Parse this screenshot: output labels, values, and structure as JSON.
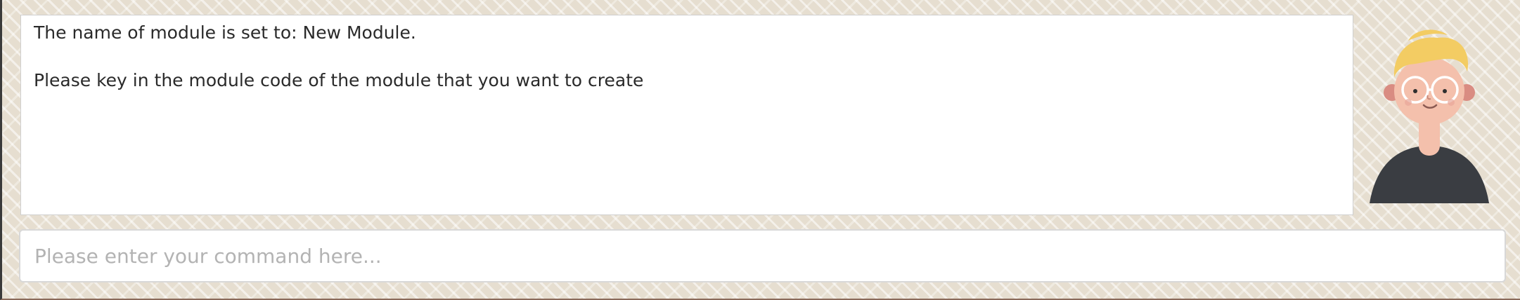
{
  "result_display": {
    "lines": [
      "The name of module is set to: New Module.",
      "Please key in the module code of the module that you want to create"
    ]
  },
  "command_box": {
    "placeholder": "Please enter your command here...",
    "value": ""
  },
  "avatar": {
    "icon": "assistant-avatar-icon",
    "colors": {
      "hair": "#f3cc63",
      "skin": "#f4c0ac",
      "ears": "#d98c82",
      "shirt": "#3a3d42",
      "glasses": "#ffffff"
    }
  }
}
